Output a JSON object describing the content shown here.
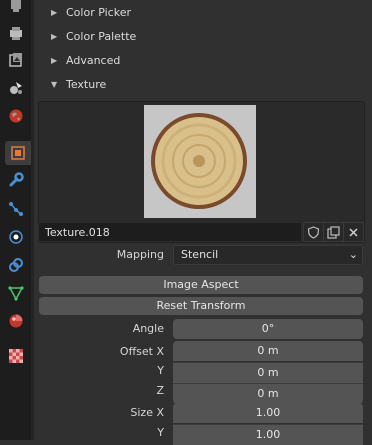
{
  "sidebar": {
    "tabs": [
      {
        "icon": "tool-icon"
      },
      {
        "icon": "render-icon"
      },
      {
        "icon": "output-icon"
      },
      {
        "icon": "view-layer-icon"
      },
      {
        "icon": "scene-icon"
      },
      {
        "icon": "world-icon"
      },
      {
        "icon": "object-icon"
      },
      {
        "icon": "modifier-wrench-icon"
      },
      {
        "icon": "particles-icon"
      },
      {
        "icon": "physics-icon"
      },
      {
        "icon": "constraints-icon"
      },
      {
        "icon": "object-data-mesh-icon"
      },
      {
        "icon": "material-icon"
      },
      {
        "icon": "texture-checker-icon"
      }
    ]
  },
  "panels": {
    "color_picker": "Color Picker",
    "color_palette": "Color Palette",
    "advanced": "Advanced",
    "texture": "Texture"
  },
  "texture": {
    "name": "Texture.018",
    "mapping_label": "Mapping",
    "mapping_value": "Stencil",
    "image_aspect": "Image Aspect",
    "reset_transform": "Reset Transform"
  },
  "props": {
    "angle_label": "Angle",
    "angle_value": "0°",
    "offset_x_label": "Offset X",
    "offset_x_value": "0 m",
    "offset_y_label": "Y",
    "offset_y_value": "0 m",
    "offset_z_label": "Z",
    "offset_z_value": "0 m",
    "size_x_label": "Size X",
    "size_x_value": "1.00",
    "size_y_label": "Y",
    "size_y_value": "1.00"
  },
  "colors": {
    "background": "#303030",
    "field": "#545454",
    "sidebar": "#1d1d1d",
    "accent_orange": "#e8793c"
  }
}
